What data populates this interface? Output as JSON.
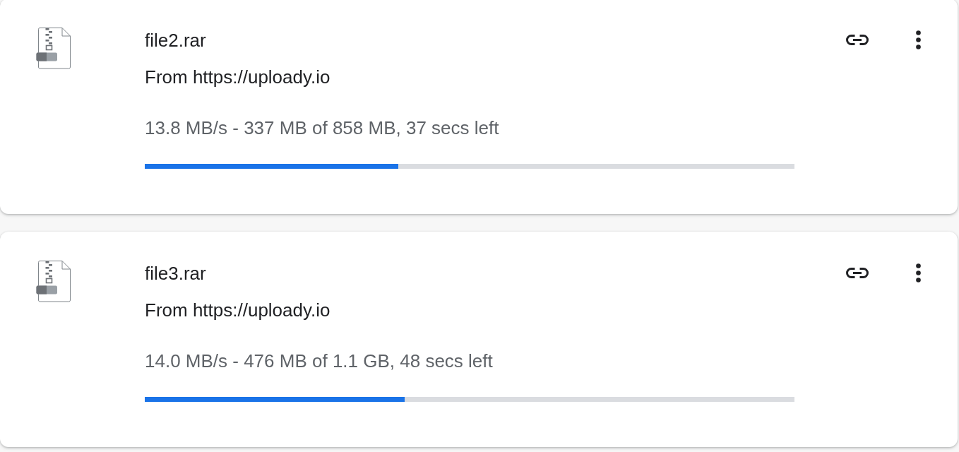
{
  "downloads": [
    {
      "file_name": "file2.rar",
      "source": "From https://uploady.io",
      "status": "13.8 MB/s - 337 MB of 858 MB, 37 secs left",
      "level": 0.39
    },
    {
      "file_name": "file3.rar",
      "source": "From https://uploady.io",
      "status": "14.0 MB/s - 476 MB of 1.1 GB, 48 secs left",
      "level": 0.4
    }
  ]
}
